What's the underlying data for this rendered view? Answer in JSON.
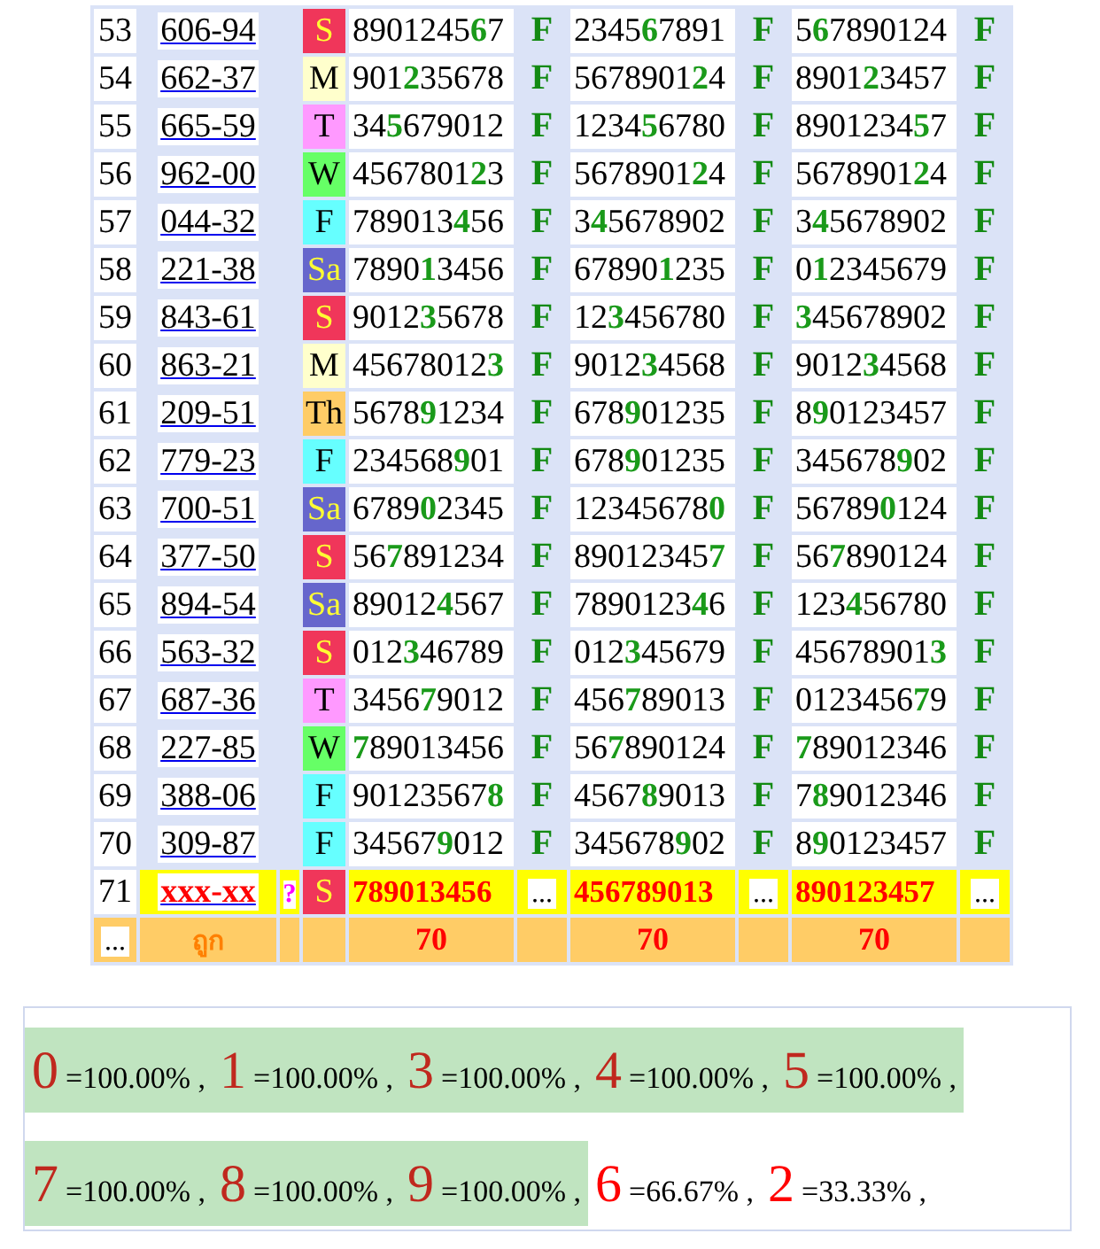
{
  "rows": [
    {
      "kind": "draw",
      "index": "53",
      "code": "606-94",
      "day": "S",
      "color": "#f0365a",
      "results": [
        {
          "number": "8901245**6**7",
          "mark": "F"
        },
        {
          "number": "2345**6**7891",
          "mark": "F"
        },
        {
          "number": "5**6**7890124",
          "mark": "F"
        }
      ]
    },
    {
      "kind": "draw",
      "index": "54",
      "code": "662-37",
      "day": "M",
      "color": "#ffffcc",
      "results": [
        {
          "number": "901**2**35678",
          "mark": "F"
        },
        {
          "number": "5678901**2**4",
          "mark": "F"
        },
        {
          "number": "8901**2**3457",
          "mark": "F"
        }
      ]
    },
    {
      "kind": "draw",
      "index": "55",
      "code": "665-59",
      "day": "T",
      "color": "#ff99ff",
      "results": [
        {
          "number": "34**5**679012",
          "mark": "F"
        },
        {
          "number": "1234**5**6780",
          "mark": "F"
        },
        {
          "number": "8901234**5**7",
          "mark": "F"
        }
      ]
    },
    {
      "kind": "draw",
      "index": "56",
      "code": "962-00",
      "day": "W",
      "color": "#66ff66",
      "results": [
        {
          "number": "4567801**2**3",
          "mark": "F"
        },
        {
          "number": "5678901**2**4",
          "mark": "F"
        },
        {
          "number": "5678901**2**4",
          "mark": "F"
        }
      ]
    },
    {
      "kind": "draw",
      "index": "57",
      "code": "044-32",
      "day": "F",
      "color": "#66ffff",
      "results": [
        {
          "number": "789013**4**56",
          "mark": "F"
        },
        {
          "number": "3**4**5678902",
          "mark": "F"
        },
        {
          "number": "3**4**5678902",
          "mark": "F"
        }
      ]
    },
    {
      "kind": "draw",
      "index": "58",
      "code": "221-38",
      "day": "Sa",
      "color": "#6666cc",
      "results": [
        {
          "number": "7890**1**3456",
          "mark": "F"
        },
        {
          "number": "67890**1**235",
          "mark": "F"
        },
        {
          "number": "0**1**2345679",
          "mark": "F"
        }
      ]
    },
    {
      "kind": "draw",
      "index": "59",
      "code": "843-61",
      "day": "S",
      "color": "#f0365a",
      "results": [
        {
          "number": "9012**3**5678",
          "mark": "F"
        },
        {
          "number": "12**3**456780",
          "mark": "F"
        },
        {
          "number": "**3**45678902",
          "mark": "F"
        }
      ]
    },
    {
      "kind": "draw",
      "index": "60",
      "code": "863-21",
      "day": "M",
      "color": "#ffffcc",
      "results": [
        {
          "number": "45678012**3**",
          "mark": "F"
        },
        {
          "number": "9012**3**4568",
          "mark": "F"
        },
        {
          "number": "9012**3**4568",
          "mark": "F"
        }
      ]
    },
    {
      "kind": "draw",
      "index": "61",
      "code": "209-51",
      "day": "Th",
      "color": "#ffcc66",
      "results": [
        {
          "number": "5678**9**1234",
          "mark": "F"
        },
        {
          "number": "678**9**01235",
          "mark": "F"
        },
        {
          "number": "8**9**0123457",
          "mark": "F"
        }
      ]
    },
    {
      "kind": "draw",
      "index": "62",
      "code": "779-23",
      "day": "F",
      "color": "#66ffff",
      "results": [
        {
          "number": "234568**9**01",
          "mark": "F"
        },
        {
          "number": "678**9**01235",
          "mark": "F"
        },
        {
          "number": "345678**9**02",
          "mark": "F"
        }
      ]
    },
    {
      "kind": "draw",
      "index": "63",
      "code": "700-51",
      "day": "Sa",
      "color": "#6666cc",
      "results": [
        {
          "number": "6789**0**2345",
          "mark": "F"
        },
        {
          "number": "12345678**0**",
          "mark": "F"
        },
        {
          "number": "56789**0**124",
          "mark": "F"
        }
      ]
    },
    {
      "kind": "draw",
      "index": "64",
      "code": "377-50",
      "day": "S",
      "color": "#f0365a",
      "results": [
        {
          "number": "56**7**891234",
          "mark": "F"
        },
        {
          "number": "89012345**7**",
          "mark": "F"
        },
        {
          "number": "56**7**890124",
          "mark": "F"
        }
      ]
    },
    {
      "kind": "draw",
      "index": "65",
      "code": "894-54",
      "day": "Sa",
      "color": "#6666cc",
      "results": [
        {
          "number": "89012**4**567",
          "mark": "F"
        },
        {
          "number": "7890123**4**6",
          "mark": "F"
        },
        {
          "number": "123**4**56780",
          "mark": "F"
        }
      ]
    },
    {
      "kind": "draw",
      "index": "66",
      "code": "563-32",
      "day": "S",
      "color": "#f0365a",
      "results": [
        {
          "number": "012**3**46789",
          "mark": "F"
        },
        {
          "number": "012**3**45679",
          "mark": "F"
        },
        {
          "number": "45678901**3**",
          "mark": "F"
        }
      ]
    },
    {
      "kind": "draw",
      "index": "67",
      "code": "687-36",
      "day": "T",
      "color": "#ff99ff",
      "results": [
        {
          "number": "3456**7**9012",
          "mark": "F"
        },
        {
          "number": "456**7**89013",
          "mark": "F"
        },
        {
          "number": "0123456**7**9",
          "mark": "F"
        }
      ]
    },
    {
      "kind": "draw",
      "index": "68",
      "code": "227-85",
      "day": "W",
      "color": "#66ff66",
      "results": [
        {
          "number": "**7**89013456",
          "mark": "F"
        },
        {
          "number": "56**7**890124",
          "mark": "F"
        },
        {
          "number": "**7**89012346",
          "mark": "F"
        }
      ]
    },
    {
      "kind": "draw",
      "index": "69",
      "code": "388-06",
      "day": "F",
      "color": "#66ffff",
      "results": [
        {
          "number": "90123567**8**",
          "mark": "F"
        },
        {
          "number": "4567**8**9013",
          "mark": "F"
        },
        {
          "number": "7**8**9012346",
          "mark": "F"
        }
      ]
    },
    {
      "kind": "draw",
      "index": "70",
      "code": "309-87",
      "day": "F",
      "color": "#66ffff",
      "results": [
        {
          "number": "34567**9**012",
          "mark": "F"
        },
        {
          "number": "345678**9**02",
          "mark": "F"
        },
        {
          "number": "8**9**0123457",
          "mark": "F"
        }
      ]
    },
    {
      "kind": "pending",
      "index": "71",
      "code": "xxx-xx",
      "flag": "?",
      "day": "S",
      "color": "#f0365a",
      "results": [
        {
          "number": "789013456",
          "mark": "..."
        },
        {
          "number": "456789013",
          "mark": "..."
        },
        {
          "number": "890123457",
          "mark": "..."
        }
      ]
    }
  ],
  "footer": {
    "more": "...",
    "label": "ถูก",
    "totals": [
      "70",
      "70",
      "70"
    ]
  },
  "stats": [
    {
      "digit": "0",
      "text": "=100.00% ,",
      "hit": true
    },
    {
      "digit": "1",
      "text": "=100.00% ,",
      "hit": true
    },
    {
      "digit": "3",
      "text": "=100.00% ,",
      "hit": true
    },
    {
      "digit": "4",
      "text": "=100.00% ,",
      "hit": true
    },
    {
      "digit": "5",
      "text": "=100.00% ,",
      "hit": true
    },
    {
      "digit": "7",
      "text": "=100.00% ,",
      "hit": true
    },
    {
      "digit": "8",
      "text": "=100.00% ,",
      "hit": true
    },
    {
      "digit": "9",
      "text": "=100.00% ,",
      "hit": true
    },
    {
      "digit": "6",
      "text": "=66.67% ,",
      "hit": false
    },
    {
      "digit": "2",
      "text": "=33.33% ,",
      "hit": false
    }
  ]
}
